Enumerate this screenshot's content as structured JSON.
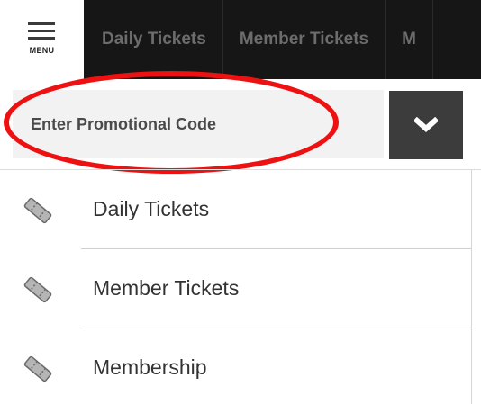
{
  "header": {
    "menu_label": "MENU",
    "tabs": [
      {
        "label": "Daily Tickets"
      },
      {
        "label": "Member Tickets"
      },
      {
        "label": "M"
      }
    ]
  },
  "promo": {
    "placeholder": "Enter Promotional Code",
    "button_icon": "chevron-down-icon",
    "highlight_color": "#ee1111"
  },
  "menu_list": {
    "items": [
      {
        "label": "Daily Tickets",
        "icon": "ticket-icon"
      },
      {
        "label": "Member Tickets",
        "icon": "ticket-icon"
      },
      {
        "label": "Membership",
        "icon": "ticket-icon"
      }
    ]
  },
  "colors": {
    "tab_bar_bg": "#161616",
    "tab_text": "#6c6c6c",
    "promo_button_bg": "#3c3c3c"
  }
}
